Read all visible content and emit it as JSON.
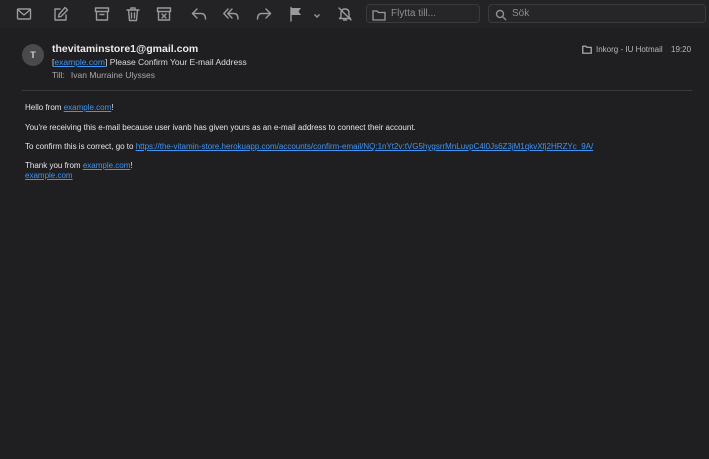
{
  "toolbar": {
    "icons": [
      "envelope-icon",
      "compose-icon",
      "archive-icon",
      "trash-icon",
      "junk-icon",
      "reply-icon",
      "reply-all-icon",
      "forward-icon",
      "flag-icon",
      "chevron-down-icon",
      "bell-slash-icon"
    ],
    "move_placeholder": "Flytta till...",
    "search_placeholder": "Sök"
  },
  "message": {
    "avatar_initial": "T",
    "sender": "thevitaminstore1@gmail.com",
    "subject_prefix_open": "[",
    "subject_link": "example.com",
    "subject_prefix_close": "]",
    "subject": "Please Confirm Your E-mail Address",
    "to_label": "Till:",
    "to_name": "Ivan Murraine Ulysses",
    "mailbox": "Inkorg - IU Hotmail",
    "time": "19:20"
  },
  "body": {
    "greeting_prefix": "Hello from ",
    "greeting_link": "example.com",
    "greeting_suffix": "!",
    "line1": "You're receiving this e-mail because user ivanb has given yours as an e-mail address to connect their account.",
    "confirm_prefix": "To confirm this is correct, go to ",
    "confirm_link": "https://the-vitamin-store.herokuapp.com/accounts/confirm-email/NQ:1nYt2v:tVG5hygsrrMnLuvpC4l0Js6Z3jM1qkvXfj2HRZYc_9A/",
    "thanks_prefix": "Thank you from ",
    "thanks_link": "example.com",
    "thanks_suffix": "!",
    "signature_link": "example.com"
  },
  "colors": {
    "background": "#1f1f21",
    "link": "#3f95f5",
    "text": "#e6e6e6"
  }
}
